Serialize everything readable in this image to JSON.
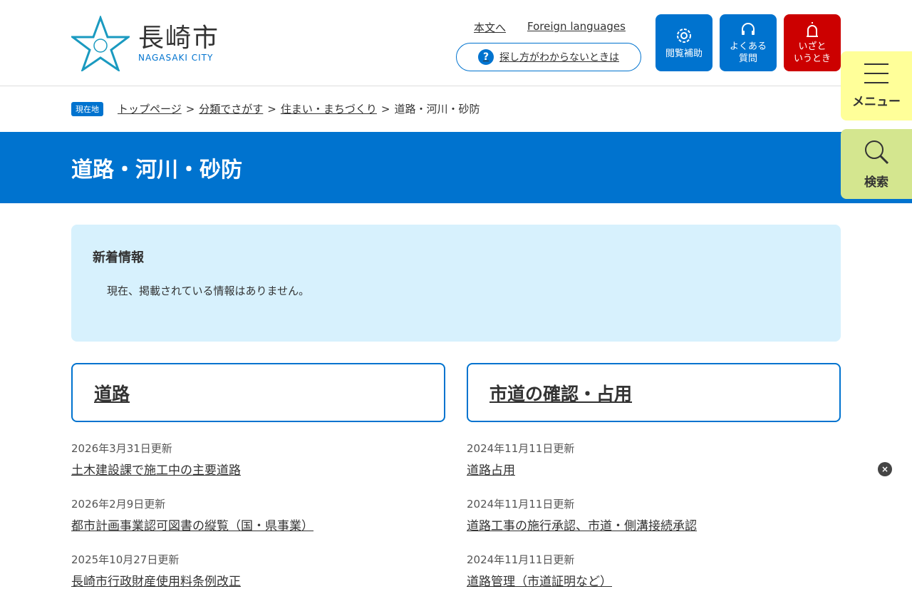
{
  "logo": {
    "jp": "長崎市",
    "en": "NAGASAKI CITY"
  },
  "toplinks": {
    "main": "本文へ",
    "foreign": "Foreign languages"
  },
  "help": "探し方がわからないときは",
  "buttons": {
    "accessibility": "閲覧補助",
    "faq1": "よくある",
    "faq2": "質問",
    "emergency1": "いざと",
    "emergency2": "いうとき",
    "menu": "メニュー",
    "search": "検索"
  },
  "colors": {
    "accent": "#0073cf",
    "emergency": "#cc0000",
    "menu": "#ffff99",
    "search": "#d4e68f"
  },
  "breadcrumb": {
    "badge": "現在地",
    "items": [
      "トップページ",
      "分類でさがす",
      "住まい・まちづくり"
    ],
    "current": "道路・河川・砂防",
    "sep": ">"
  },
  "title": "道路・河川・砂防",
  "news": {
    "heading": "新着情報",
    "text": "現在、掲載されている情報はありません。"
  },
  "columns": [
    {
      "heading": "道路",
      "items": [
        {
          "date": "2026年3月31日更新",
          "title": "土木建設課で施工中の主要道路"
        },
        {
          "date": "2026年2月9日更新",
          "title": "都市計画事業認可図書の縦覧（国・県事業）"
        },
        {
          "date": "2025年10月27日更新",
          "title": "長崎市行政財産使用料条例改正"
        }
      ]
    },
    {
      "heading": "市道の確認・占用",
      "items": [
        {
          "date": "2024年11月11日更新",
          "title": "道路占用"
        },
        {
          "date": "2024年11月11日更新",
          "title": "道路工事の施行承認、市道・側溝接続承認"
        },
        {
          "date": "2024年11月11日更新",
          "title": "道路管理（市道証明など）"
        }
      ]
    }
  ],
  "close": "×"
}
